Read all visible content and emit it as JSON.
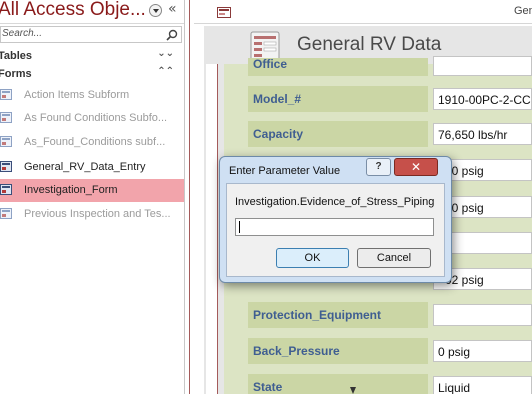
{
  "nav": {
    "title": "All Access Obje...",
    "search_placeholder": "Search...",
    "groups": [
      {
        "label": "Tables",
        "chevron": "⌄"
      },
      {
        "label": "Forms",
        "chevron": "⌃"
      }
    ],
    "items": [
      {
        "label": "Action Items Subform"
      },
      {
        "label": "As Found Conditions Subfo..."
      },
      {
        "label": "As_Found_Conditions subf..."
      },
      {
        "label": "General_RV_Data_Entry"
      },
      {
        "label": "Investigation_Form"
      },
      {
        "label": "Previous Inspection and Tes..."
      }
    ]
  },
  "document": {
    "tab_label": "Gene",
    "form_title": "General RV Data",
    "fields": [
      {
        "label": "Office",
        "value": ""
      },
      {
        "label": "Model_#",
        "value": "1910-00PC-2-CC"
      },
      {
        "label": "Capacity",
        "value": "76,650 lbs/hr"
      },
      {
        "label": "",
        "value": "20 psig"
      },
      {
        "label": "",
        "value": "00 psig"
      },
      {
        "label": "",
        "value": ""
      },
      {
        "label": "",
        "value": "02 psig"
      },
      {
        "label": "Protection_Equipment",
        "value": ""
      },
      {
        "label": "Back_Pressure",
        "value": "0 psig"
      },
      {
        "label": "State",
        "value": "Liquid"
      }
    ]
  },
  "dialog": {
    "title": "Enter Parameter Value",
    "help_label": "?",
    "close_label": "✕",
    "prompt": "Investigation.Evidence_of_Stress_Piping",
    "input_value": "",
    "ok_label": "OK",
    "cancel_label": "Cancel"
  },
  "colors": {
    "selected_item": "#f2a4ab",
    "label_text": "#3f5e91",
    "detail_bg": "#dce4c4",
    "close_button": "#c6504a"
  }
}
